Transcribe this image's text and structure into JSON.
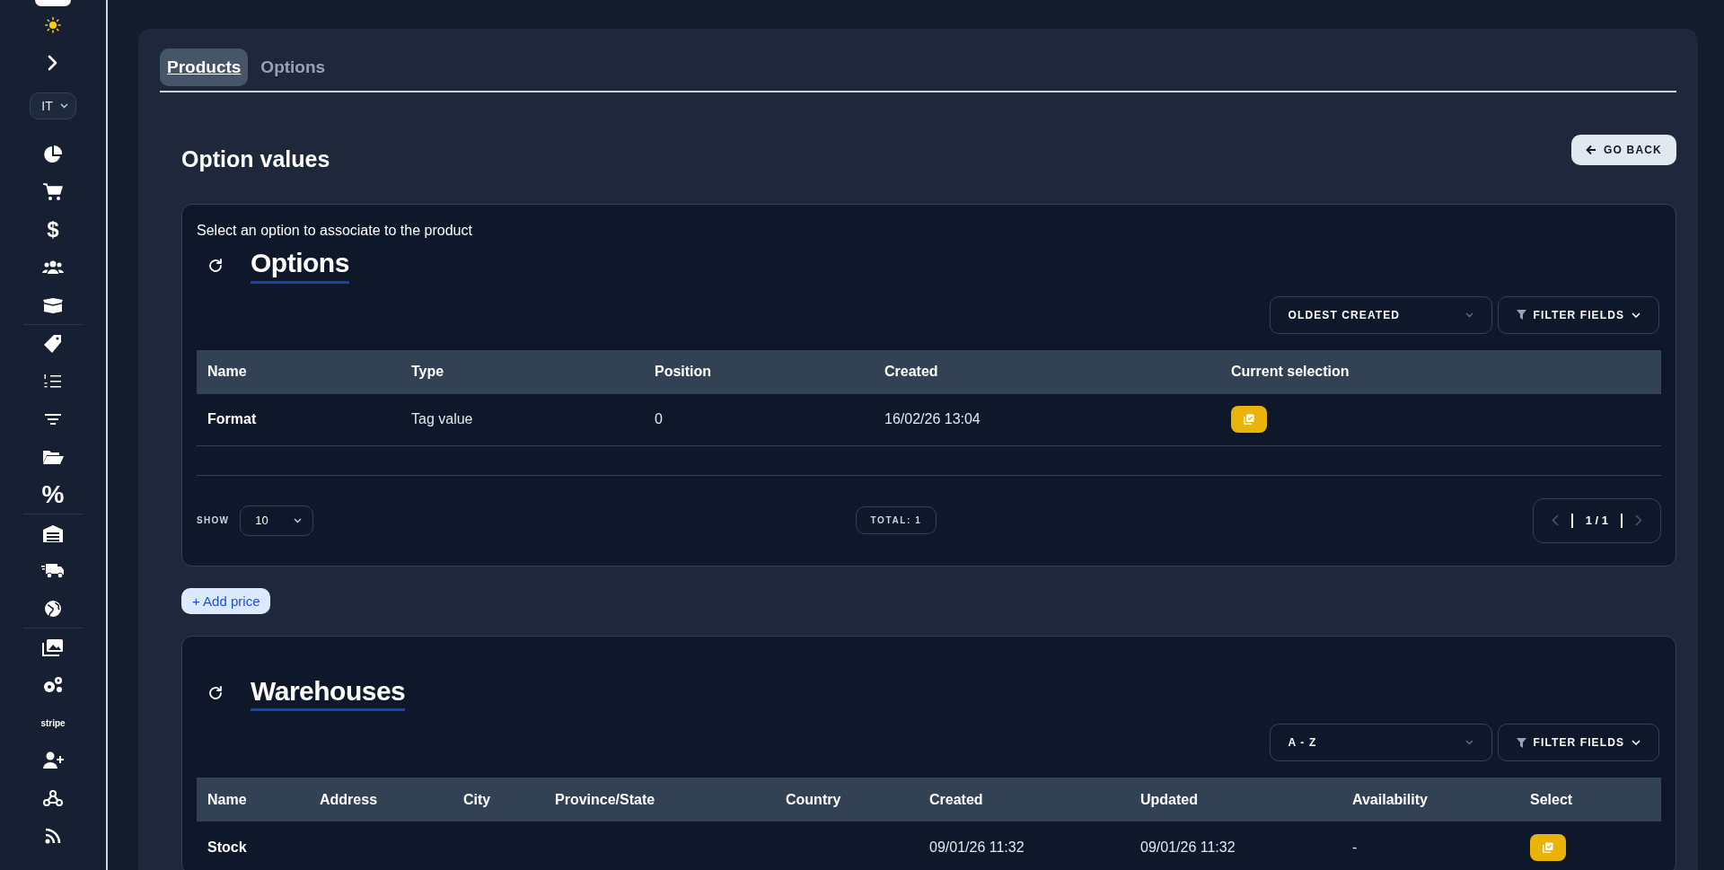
{
  "sidebar": {
    "language": "IT",
    "dollar_glyph": "$",
    "percent_glyph": "%",
    "stripe_label": "stripe"
  },
  "tabs": [
    {
      "label": "Products",
      "selected": true
    },
    {
      "label": "Options",
      "selected": false
    }
  ],
  "page_title": "Option values",
  "back_button": "GO BACK",
  "options_panel": {
    "hint": "Select an option to associate to the product",
    "title": "Options",
    "sort": "OLDEST CREATED",
    "filter": "FILTER FIELDS",
    "columns": [
      "Name",
      "Type",
      "Position",
      "Created",
      "Current selection"
    ],
    "rows": [
      {
        "cells": [
          "Format",
          "Tag value",
          "0",
          "16/02/26 13:04"
        ]
      }
    ],
    "show_label": "SHOW",
    "page_size": "10",
    "total": "TOTAL: 1",
    "page": "1 / 1"
  },
  "add_price": "+ Add price",
  "warehouses_panel": {
    "title": "Warehouses",
    "sort": "A - Z",
    "filter": "FILTER FIELDS",
    "columns": [
      "Name",
      "Address",
      "City",
      "Province/State",
      "Country",
      "Created",
      "Updated",
      "Availability",
      "Select"
    ],
    "rows": [
      {
        "cells": [
          "Stock",
          null,
          null,
          null,
          null,
          "09/01/26 11:32",
          "09/01/26 11:32",
          "-"
        ]
      }
    ]
  }
}
